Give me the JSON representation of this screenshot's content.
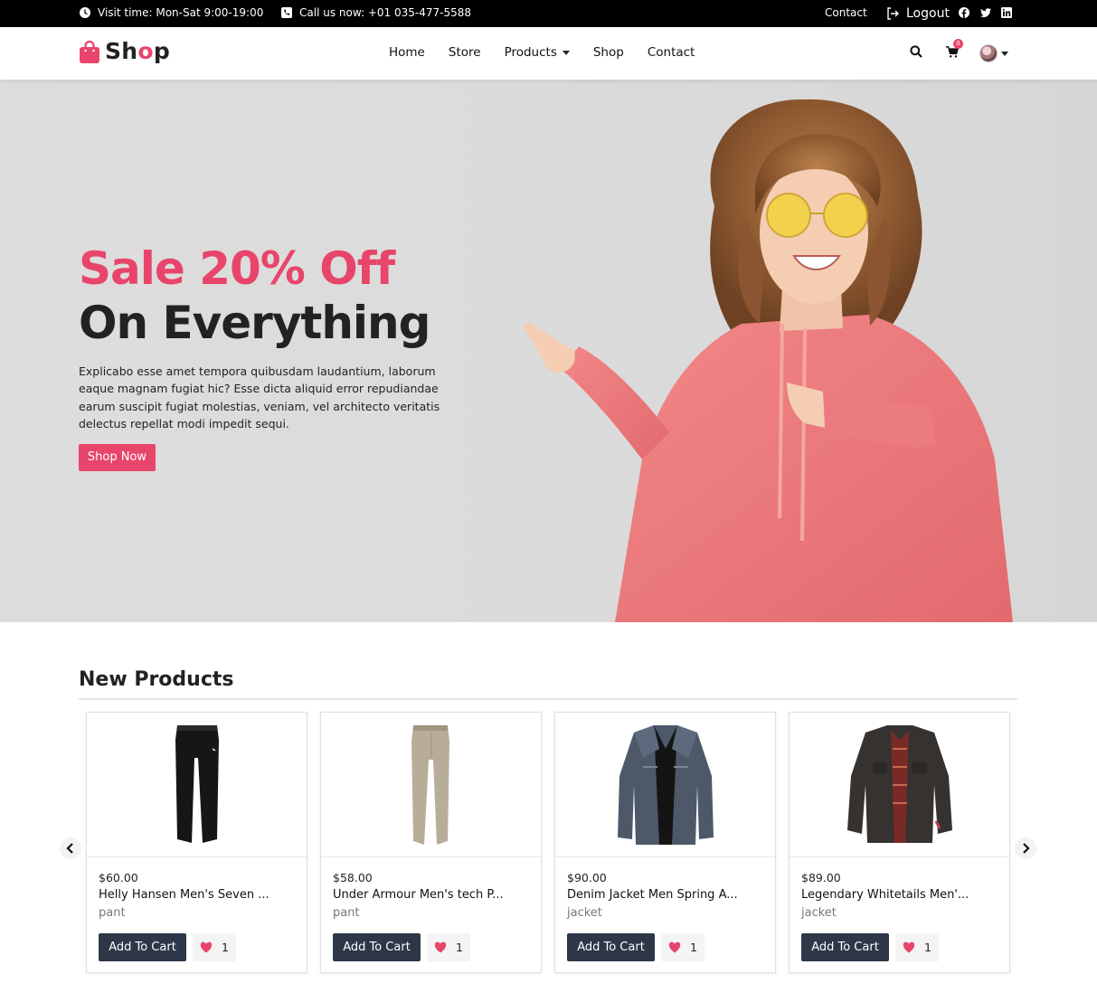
{
  "topbar": {
    "visit_time": "Visit time: Mon-Sat 9:00-19:00",
    "call_us": "Call us now: +01 035-477-5588",
    "contact": "Contact",
    "logout": "Logout",
    "social_icons": [
      "facebook-icon",
      "twitter-icon",
      "linkedin-icon"
    ]
  },
  "navbar": {
    "brand_prefix": "Sh",
    "brand_o": "o",
    "brand_suffix": "p",
    "links": [
      "Home",
      "Store",
      "Products",
      "Shop",
      "Contact"
    ],
    "cart_count": "0"
  },
  "hero": {
    "headline_1": "Sale 20% Off",
    "headline_2": "On Everything",
    "description": "Explicabo esse amet tempora quibusdam laudantium, laborum eaque magnam fugiat hic? Esse dicta aliquid error repudiandae earum suscipit fugiat molestias, veniam, vel architecto veritatis delectus repellat modi impedit sequi.",
    "button": "Shop Now"
  },
  "section": {
    "title": "New Products"
  },
  "products": [
    {
      "price": "$60.00",
      "name": "Helly Hansen Men's Seven ...",
      "category": "pant",
      "cart_label": "Add To Cart",
      "likes": "1",
      "image": "black-pants"
    },
    {
      "price": "$58.00",
      "name": "Under Armour Men's tech P...",
      "category": "pant",
      "cart_label": "Add To Cart",
      "likes": "1",
      "image": "khaki-pants"
    },
    {
      "price": "$90.00",
      "name": "Denim Jacket Men Spring A...",
      "category": "jacket",
      "cart_label": "Add To Cart",
      "likes": "1",
      "image": "denim-jacket"
    },
    {
      "price": "$89.00",
      "name": "Legendary Whitetails Men'...",
      "category": "jacket",
      "cart_label": "Add To Cart",
      "likes": "1",
      "image": "dark-jacket"
    }
  ],
  "colors": {
    "accent": "#e8456b",
    "dark_button": "#2d3748",
    "topbar": "#000000"
  }
}
